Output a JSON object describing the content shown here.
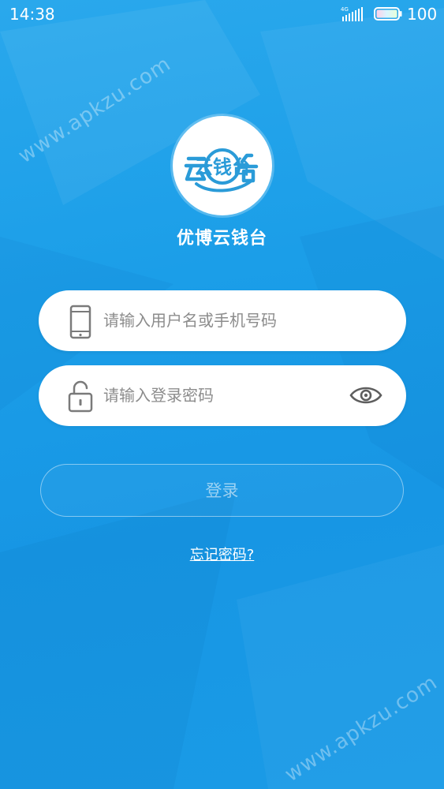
{
  "status_bar": {
    "time": "14:38",
    "network": "4G",
    "battery_level": "100",
    "signal_icon": "signal-icon",
    "battery_icon": "battery-icon"
  },
  "watermark": {
    "top": "www.apkzu.com",
    "bottom": "www.apkzu.com"
  },
  "logo": {
    "icon": "yunqiantai-logo-icon",
    "text": "云钱台"
  },
  "app": {
    "name": "优博云钱台"
  },
  "form": {
    "username": {
      "placeholder": "请输入用户名或手机号码",
      "value": "",
      "icon": "phone-icon"
    },
    "password": {
      "placeholder": "请输入登录密码",
      "value": "",
      "icon": "unlock-icon",
      "toggle_icon": "eye-icon"
    },
    "login_label": "登录",
    "forgot_label": "忘记密码?"
  },
  "colors": {
    "background": "#1b9ee8",
    "logo_blue": "#2a9bd8",
    "field_bg": "#ffffff",
    "placeholder": "#8c8c8c"
  }
}
